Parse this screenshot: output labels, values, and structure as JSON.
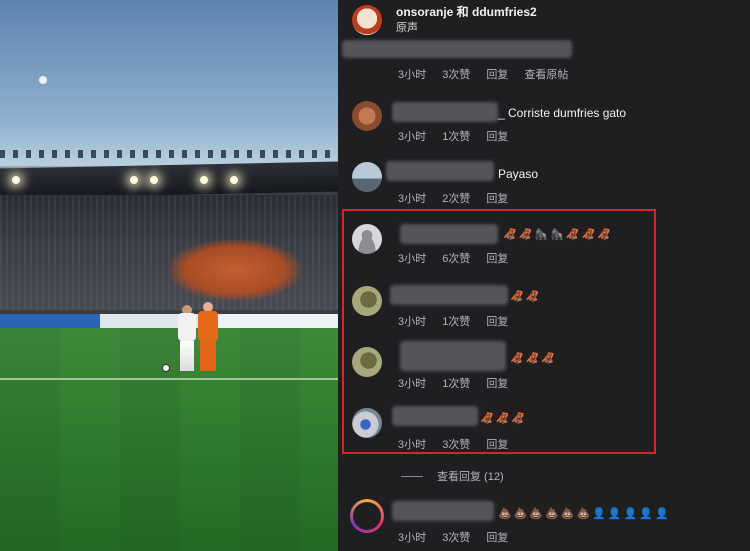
{
  "header": {
    "names": "onsoranje 和 ddumfries2",
    "subtitle": "原声"
  },
  "comments": [
    {
      "text": "",
      "time": "3小时",
      "likes": "3次赞",
      "reply": "回复",
      "extra": "查看原帖"
    },
    {
      "text": "_ Corriste dumfries gato",
      "time": "3小时",
      "likes": "1次赞",
      "reply": "回复"
    },
    {
      "text": "Payaso",
      "time": "3小时",
      "likes": "2次赞",
      "reply": "回复"
    },
    {
      "text": "",
      "time": "3小时",
      "likes": "6次赞",
      "reply": "回复",
      "emojis": [
        "🦧",
        "🦧",
        "🦍",
        "🦍",
        "🦧",
        "🦧",
        "🦧"
      ]
    },
    {
      "text": "",
      "time": "3小时",
      "likes": "1次赞",
      "reply": "回复",
      "emojis": [
        "🦧",
        "🦧"
      ]
    },
    {
      "text": "",
      "time": "3小时",
      "likes": "1次赞",
      "reply": "回复",
      "emojis": [
        "🦧",
        "🦧",
        "🦧"
      ]
    },
    {
      "text": "",
      "time": "3小时",
      "likes": "3次赞",
      "reply": "回复",
      "emojis": [
        "🦧",
        "🦧",
        "🦧"
      ]
    },
    {
      "text": "",
      "time": "3小时",
      "likes": "3次赞",
      "reply": "回复",
      "emojis": [
        "💩",
        "💩",
        "💩",
        "💩",
        "💩",
        "💩",
        "👤",
        "👤",
        "👤",
        "👤",
        "👤"
      ]
    }
  ],
  "view_replies": "查看回复 (12)",
  "colors": {
    "highlight": "#d7252d",
    "background": "#1f1f22"
  }
}
